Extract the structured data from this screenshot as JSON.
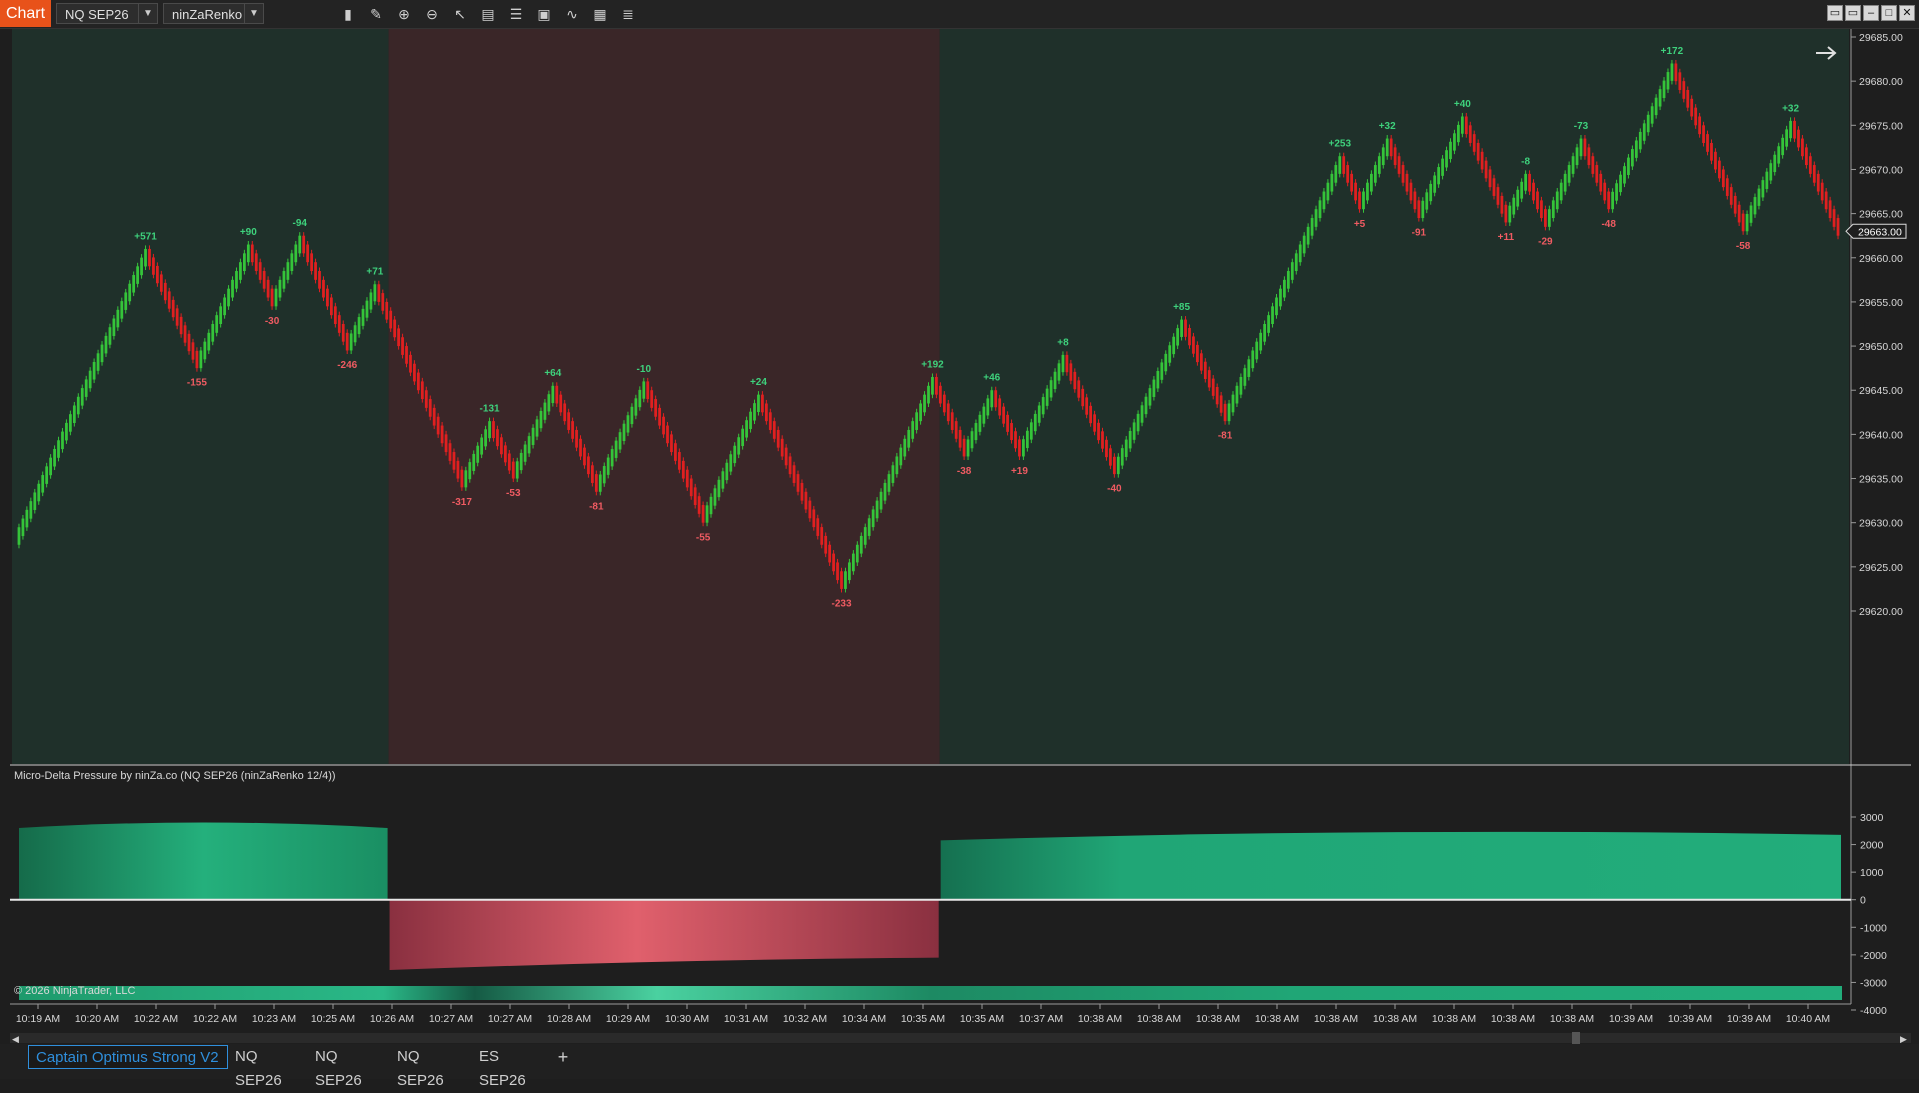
{
  "toolbar": {
    "title": "Chart",
    "instrument": "NQ SEP26",
    "bar_type": "ninZaRenko 12/4",
    "icons": [
      "bar-chart-icon",
      "draw-pencil-icon",
      "zoom-in-icon",
      "zoom-out-icon",
      "pointer-icon",
      "data-box-icon",
      "indicators-icon",
      "strategies-icon",
      "templates-icon",
      "properties-icon",
      "list-icon"
    ],
    "window_buttons": [
      "restore",
      "restore",
      "minimize",
      "maximize",
      "close"
    ]
  },
  "price_panel": {
    "axis_labels": [
      "29685.00",
      "29680.00",
      "29675.00",
      "29670.00",
      "29665.00",
      "29660.00",
      "29655.00",
      "29650.00",
      "29645.00",
      "29640.00",
      "29635.00",
      "29630.00",
      "29625.00",
      "29620.00"
    ],
    "current_price": "29663.00",
    "colors": {
      "up": "#35c43a",
      "down": "#e02020",
      "label_up": "#3ed17c",
      "label_down": "#f05b62",
      "bg_green": "#1f302a",
      "bg_red": "#3a2628"
    }
  },
  "indicator_panel": {
    "title": "Micro-Delta Pressure by ninZa.co (NQ SEP26 (ninZaRenko 12/4))",
    "axis_labels": [
      "3000",
      "2000",
      "1000",
      "0",
      "-1000",
      "-2000",
      "-3000",
      "-4000"
    ],
    "copyright": "© 2026 NinjaTrader, LLC"
  },
  "time_axis": [
    "10:19 AM",
    "10:20 AM",
    "10:22 AM",
    "10:22 AM",
    "10:23 AM",
    "10:25 AM",
    "10:26 AM",
    "10:27 AM",
    "10:27 AM",
    "10:28 AM",
    "10:29 AM",
    "10:30 AM",
    "10:31 AM",
    "10:32 AM",
    "10:34 AM",
    "10:35 AM",
    "10:35 AM",
    "10:37 AM",
    "10:38 AM",
    "10:38 AM",
    "10:38 AM",
    "10:38 AM",
    "10:38 AM",
    "10:38 AM",
    "10:38 AM",
    "10:38 AM",
    "10:38 AM",
    "10:39 AM",
    "10:39 AM",
    "10:39 AM",
    "10:40 AM"
  ],
  "chart_data": {
    "type": "candlestick",
    "title": "",
    "ylim": [
      29618,
      29686
    ],
    "swings": [
      {
        "price": 29628,
        "label": ""
      },
      {
        "price": 29660.5,
        "label": "+571"
      },
      {
        "price": 29648,
        "label": "-155"
      },
      {
        "price": 29661,
        "label": "+90"
      },
      {
        "price": 29655,
        "label": "-30"
      },
      {
        "price": 29662,
        "label": "-94"
      },
      {
        "price": 29650,
        "label": "-246"
      },
      {
        "price": 29656.5,
        "label": "+71"
      },
      {
        "price": 29634.5,
        "label": "-317"
      },
      {
        "price": 29641,
        "label": "-131"
      },
      {
        "price": 29635.5,
        "label": "-53"
      },
      {
        "price": 29645,
        "label": "+64"
      },
      {
        "price": 29634,
        "label": "-81"
      },
      {
        "price": 29645.5,
        "label": "-10"
      },
      {
        "price": 29630.5,
        "label": "-55"
      },
      {
        "price": 29644,
        "label": "+24"
      },
      {
        "price": 29623,
        "label": "-233"
      },
      {
        "price": 29646,
        "label": "+192"
      },
      {
        "price": 29638,
        "label": "-38"
      },
      {
        "price": 29644.5,
        "label": "+46"
      },
      {
        "price": 29638,
        "label": "+19"
      },
      {
        "price": 29648.5,
        "label": "+8"
      },
      {
        "price": 29636,
        "label": "-40"
      },
      {
        "price": 29652.5,
        "label": "+85"
      },
      {
        "price": 29642,
        "label": "-81"
      },
      {
        "price": 29671,
        "label": "+253"
      },
      {
        "price": 29666,
        "label": "+5"
      },
      {
        "price": 29673,
        "label": "+32"
      },
      {
        "price": 29665,
        "label": "-91"
      },
      {
        "price": 29675.5,
        "label": "+40"
      },
      {
        "price": 29664.5,
        "label": "+11"
      },
      {
        "price": 29669,
        "label": "-8"
      },
      {
        "price": 29664,
        "label": "-29"
      },
      {
        "price": 29673,
        "label": "-73"
      },
      {
        "price": 29666,
        "label": "-48"
      },
      {
        "price": 29681.5,
        "label": "+172"
      },
      {
        "price": 29663.5,
        "label": "-58"
      },
      {
        "price": 29675,
        "label": "+32"
      },
      {
        "price": 29663,
        "label": ""
      }
    ],
    "regions": [
      {
        "state": "bull",
        "from": 0.0,
        "to": 0.205
      },
      {
        "state": "bear",
        "from": 0.205,
        "to": 0.505
      },
      {
        "state": "bull",
        "from": 0.505,
        "to": 1.0
      }
    ],
    "pressure": {
      "ylim": [
        -4700,
        3300
      ],
      "segments": [
        {
          "state": "bull",
          "from": 0.0,
          "to": 0.205,
          "start": 2600,
          "peak": 2800,
          "end": 2600
        },
        {
          "state": "bear",
          "from": 0.205,
          "to": 0.505,
          "start": -2550,
          "peak": -2250,
          "end": -2100
        },
        {
          "state": "bull",
          "from": 0.505,
          "to": 1.0,
          "start": 2150,
          "peak": 2450,
          "end": 2350
        }
      ]
    }
  },
  "tabs": {
    "items": [
      "Captain Optimus Strong V2",
      "NQ SEP26",
      "NQ SEP26",
      "NQ SEP26",
      "ES SEP26"
    ],
    "add": "+"
  }
}
